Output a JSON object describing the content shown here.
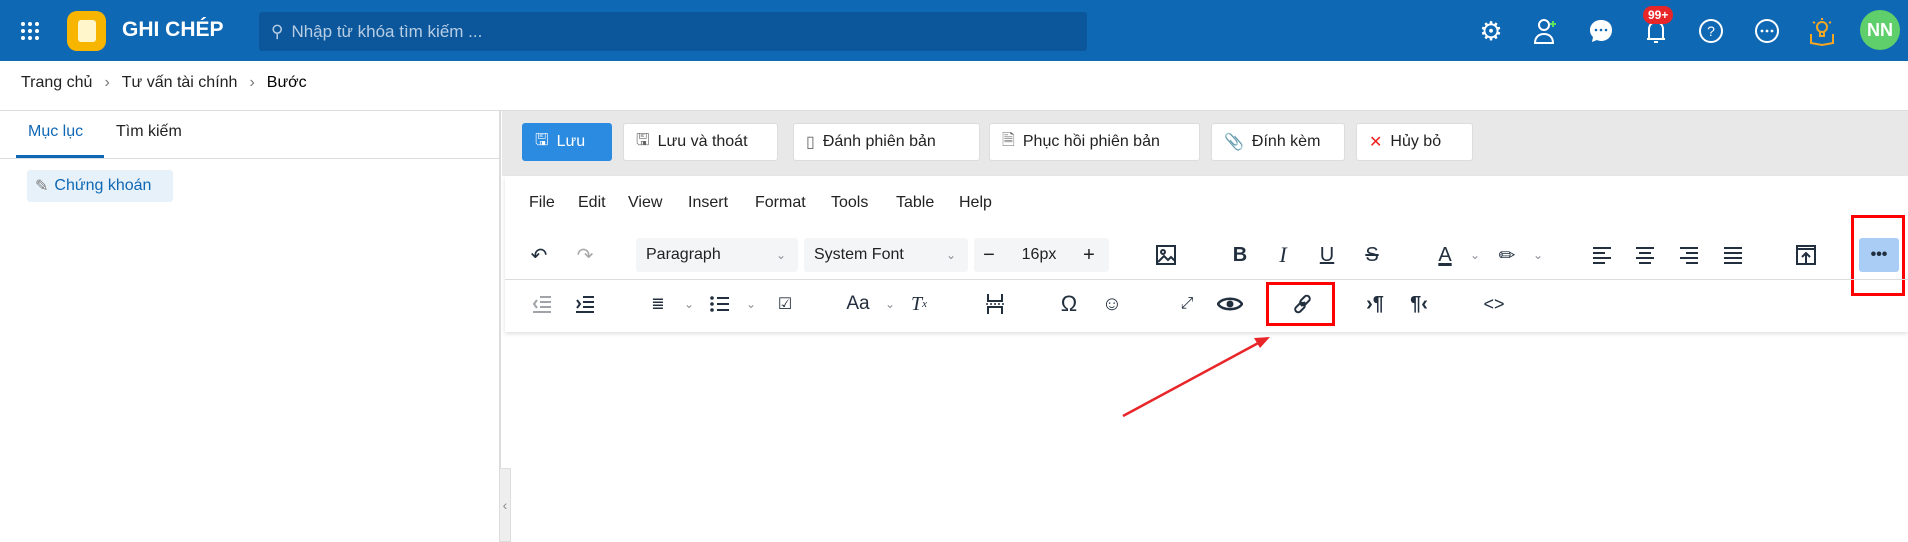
{
  "header": {
    "app_title": "GHI CHÉP",
    "search_placeholder": "Nhập từ khóa tìm kiếm ...",
    "notification_badge": "99+",
    "avatar_initials": "NN",
    "brand_color": "#0f68b4"
  },
  "breadcrumb": [
    "Trang chủ",
    "Tư vấn tài chính",
    "Bước"
  ],
  "sidebar": {
    "tabs": [
      "Mục lục",
      "Tìm kiếm"
    ],
    "items": [
      "Chứng khoán"
    ]
  },
  "actions": {
    "save": "Lưu",
    "save_exit": "Lưu và thoát",
    "version": "Đánh phiên bản",
    "restore": "Phục hồi phiên bản",
    "attach": "Đính kèm",
    "cancel": "Hủy bỏ"
  },
  "editor": {
    "menu": [
      "File",
      "Edit",
      "View",
      "Insert",
      "Format",
      "Tools",
      "Table",
      "Help"
    ],
    "block_format": "Paragraph",
    "font_family": "System Font",
    "font_size": "16px"
  }
}
